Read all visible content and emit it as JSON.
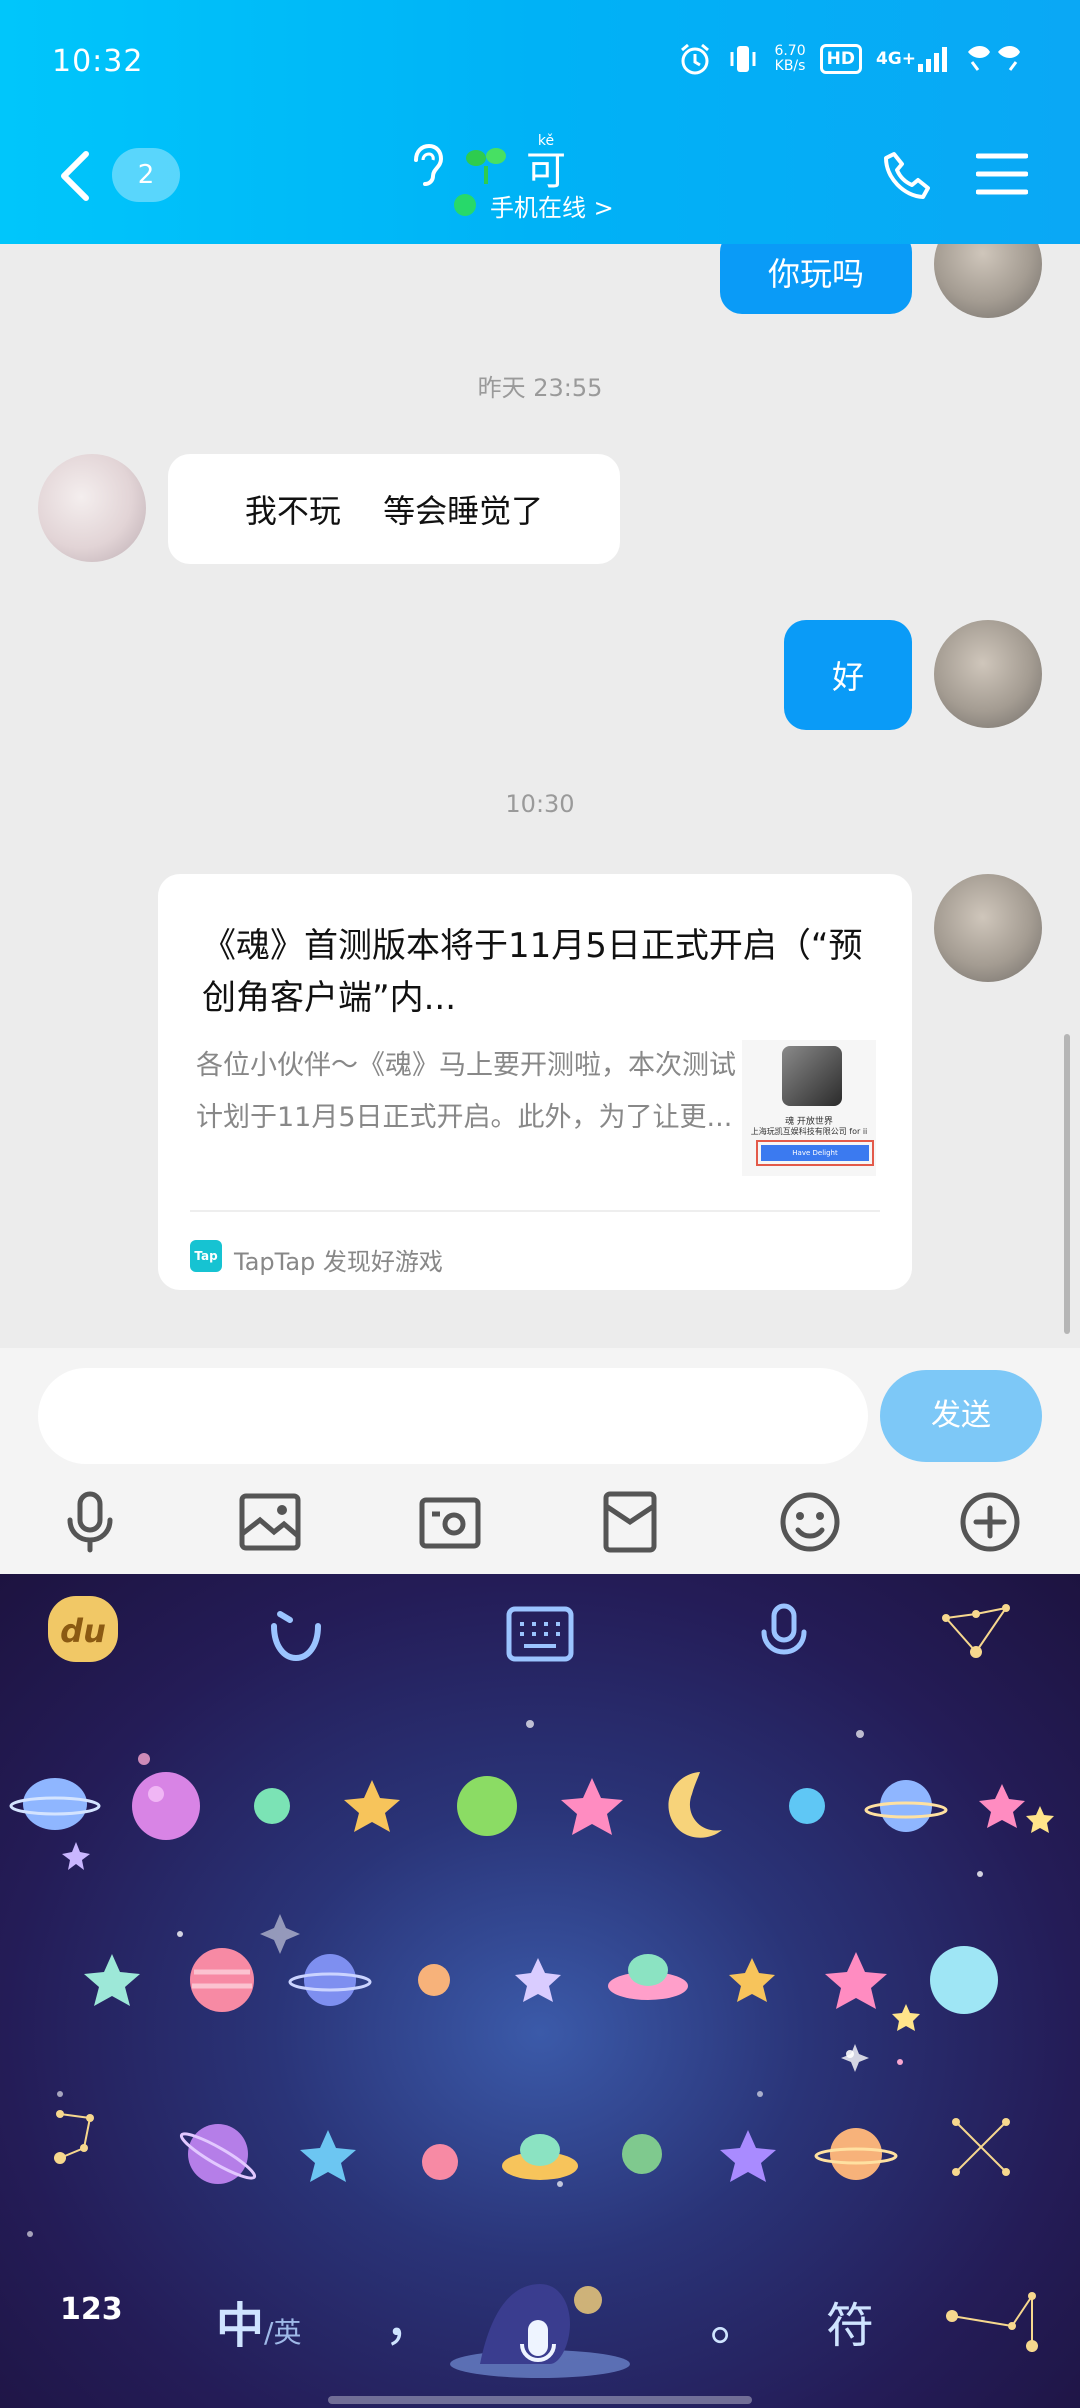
{
  "status_bar": {
    "time": "10:32",
    "net_speed_value": "6.70",
    "net_speed_unit": "KB/s",
    "hd_label": "HD",
    "signal_label": "4G+"
  },
  "header": {
    "unread_count": "2",
    "contact_name": "可",
    "contact_name_pinyin": "kě",
    "online_status": "手机在线 >"
  },
  "messages": [
    {
      "side": "me",
      "text": "你玩吗"
    },
    {
      "type": "timestamp",
      "text": "昨天 23:55"
    },
    {
      "side": "other",
      "text": "我不玩　 等会睡觉了"
    },
    {
      "side": "me",
      "text": "好"
    },
    {
      "type": "timestamp",
      "text": "10:30"
    }
  ],
  "share_card": {
    "title": "《魂》首测版本将于11月5日正式开启（“预创角客户端”内...",
    "description": "各位小伙伴～《魂》马上要开测啦，本次测试计划于11月5日正式开启。此外，为了让更...",
    "thumb_title": "魂 开放世界",
    "thumb_company": "上海玩凯互娱科技有限公司 for ii",
    "thumb_button": "Have Delight",
    "source_icon_text": "Tap",
    "source_text": "TapTap 发现好游戏"
  },
  "input_bar": {
    "placeholder": "",
    "send_label": "发送"
  },
  "keyboard": {
    "logo_text": "du",
    "key_123": "123",
    "key_zh": "中",
    "key_en": "/英",
    "key_comma": "，",
    "key_period": "。",
    "key_symbols": "符"
  },
  "colors": {
    "header_gradient_start": "#00c6fb",
    "header_gradient_end": "#0aa8f5",
    "my_bubble": "#0a9bf7",
    "send_button": "#7dc8f7",
    "online_dot": "#27d96a",
    "keyboard_bg": "#241c57"
  },
  "icons": {
    "header": [
      "back-chevron-icon",
      "ear-icon",
      "sprout-icon",
      "phone-icon",
      "menu-icon"
    ],
    "toolbar": [
      "microphone-icon",
      "image-icon",
      "camera-icon",
      "red-packet-icon",
      "emoji-icon",
      "plus-icon"
    ],
    "keyboard_top": [
      "du-logo-icon",
      "smile-icon",
      "keyboard-icon",
      "voice-icon",
      "constellation-icon"
    ]
  }
}
